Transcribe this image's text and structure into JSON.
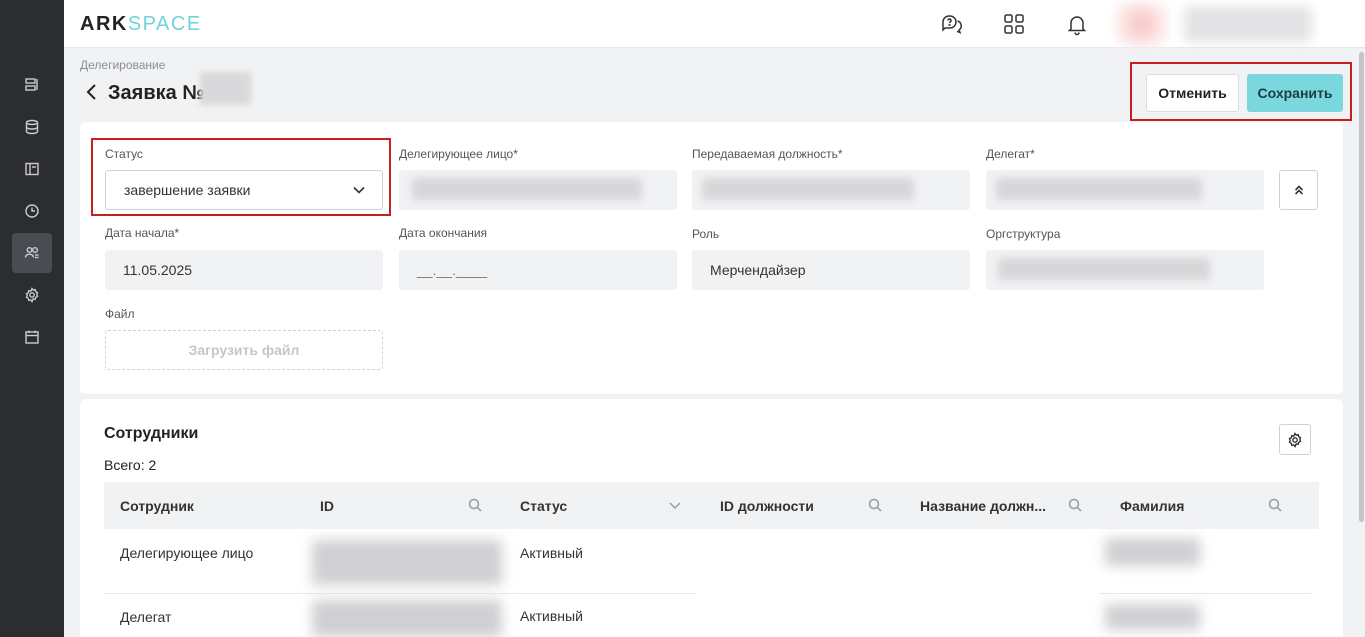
{
  "header": {
    "logo_ark": "ARK",
    "logo_space": "SPACE",
    "icons": [
      "support-chat-icon",
      "apps-grid-icon",
      "bell-icon"
    ]
  },
  "sidebar": {
    "items": [
      "list-icon",
      "database-icon",
      "book-icon",
      "clock-icon",
      "users-icon",
      "gear-icon",
      "calendar-icon"
    ],
    "active": "users-icon"
  },
  "page": {
    "breadcrumb": "Делегирование",
    "title": "Заявка №"
  },
  "actions": {
    "cancel_label": "Отменить",
    "save_label": "Сохранить"
  },
  "form": {
    "status_label": "Статус",
    "status_value": "завершение заявки",
    "delegating_label": "Делегирующее лицо*",
    "position_label": "Передаваемая должность*",
    "delegate_label": "Делегат*",
    "start_label": "Дата начала*",
    "start_value": "11.05.2025",
    "end_label": "Дата окончания",
    "end_value": "__.__.____",
    "role_label": "Роль",
    "role_value": "Мерчендайзер",
    "org_label": "Оргструктура",
    "file_label": "Файл",
    "upload_label": "Загрузить файл"
  },
  "employees": {
    "title": "Сотрудники",
    "total": "Всего: 2",
    "columns": [
      "Сотрудник",
      "ID",
      "Статус",
      "ID должности",
      "Название должн...",
      "Фамилия"
    ],
    "rows": [
      {
        "employee": "Делегирующее лицо",
        "status": "Активный"
      },
      {
        "employee": "Делегат",
        "status": "Активный"
      }
    ]
  },
  "colors": {
    "accent": "#7ad7dd",
    "highlight_border": "#c81e1e",
    "sidebar_bg": "#2c2d31"
  }
}
